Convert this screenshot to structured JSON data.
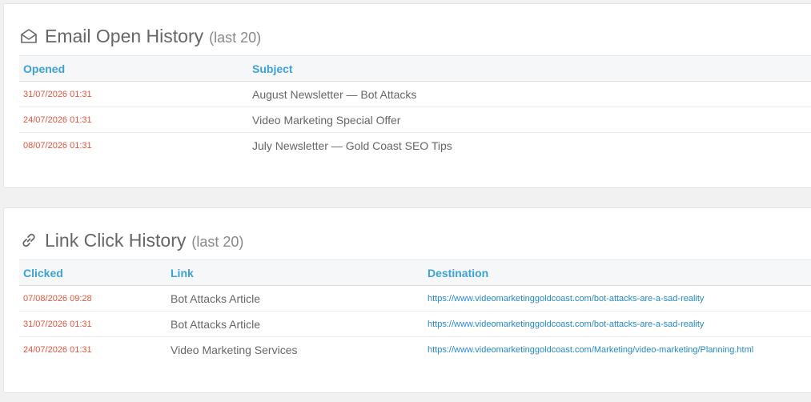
{
  "email_history": {
    "icon": "envelope-open-icon",
    "title": "Email Open History",
    "subtitle": "(last 20)",
    "columns": {
      "opened": "Opened",
      "subject": "Subject"
    },
    "rows": [
      {
        "opened": "31/07/2026 01:31",
        "subject": "August Newsletter — Bot Attacks"
      },
      {
        "opened": "24/07/2026 01:31",
        "subject": "Video Marketing Special Offer"
      },
      {
        "opened": "08/07/2026 01:31",
        "subject": "July Newsletter — Gold Coast SEO Tips"
      }
    ]
  },
  "link_history": {
    "icon": "link-icon",
    "title": "Link Click History",
    "subtitle": "(last 20)",
    "columns": {
      "clicked": "Clicked",
      "link": "Link",
      "destination": "Destination"
    },
    "rows": [
      {
        "clicked": "07/08/2026 09:28",
        "link": "Bot Attacks Article",
        "destination": "https://www.videomarketinggoldcoast.com/bot-attacks-are-a-sad-reality"
      },
      {
        "clicked": "31/07/2026 01:31",
        "link": "Bot Attacks Article",
        "destination": "https://www.videomarketinggoldcoast.com/bot-attacks-are-a-sad-reality"
      },
      {
        "clicked": "24/07/2026 01:31",
        "link": "Video Marketing Services",
        "destination": "https://www.videomarketinggoldcoast.com/Marketing/video-marketing/Planning.html"
      }
    ]
  },
  "colors": {
    "header_text": "#3aa2d6",
    "date_text": "#e2543b",
    "url_text": "#2589c7",
    "background": "#f1f1f1"
  }
}
